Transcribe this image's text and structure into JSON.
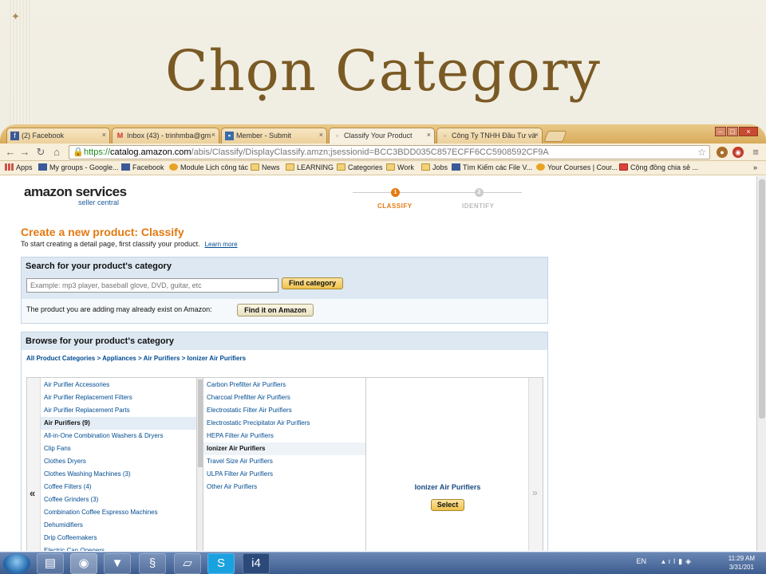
{
  "slide": {
    "title": "Chọn Category"
  },
  "browser": {
    "tabs": [
      {
        "label": "(2) Facebook",
        "icon": "facebook-icon"
      },
      {
        "label": "Inbox (43) - trinhmba@gm",
        "icon": "gmail-icon"
      },
      {
        "label": "Member - Submit",
        "icon": "page-icon"
      },
      {
        "label": "Classify Your Product",
        "icon": "page-icon"
      },
      {
        "label": "Công Ty TNHH Đầu Tư và",
        "icon": "page-icon"
      }
    ],
    "url": {
      "scheme": "https://",
      "host": "catalog.amazon.com",
      "path": "/abis/Classify/DisplayClassify.amzn;jsessionid=BCC3BDD035C857ECFF6CC5908592CF9A"
    },
    "bookmarks": [
      "Apps",
      "My groups - Google...",
      "Facebook",
      "Module Lịch công tác",
      "News",
      "LEARNING",
      "Categories",
      "Work",
      "Jobs",
      "Tìm Kiếm các File V...",
      "Your Courses | Cour...",
      "Cộng đồng chia sẻ ..."
    ],
    "bookmarks_more": "»"
  },
  "page": {
    "logo": "amazon services",
    "logo_sub": "seller central",
    "steps": [
      {
        "num": "1",
        "label": "CLASSIFY"
      },
      {
        "num": "2",
        "label": "IDENTIFY"
      }
    ],
    "heading": "Create a new product: Classify",
    "subheading": "To start creating a detail page, first classify your product.",
    "learn_more": "Learn more",
    "search": {
      "title": "Search for your product's category",
      "placeholder": "Example: mp3 player, baseball glove, DVD, guitar, etc",
      "button": "Find category",
      "exist_text": "The product you are adding may already exist on Amazon:",
      "exist_button": "Find it on Amazon"
    },
    "browse": {
      "title": "Browse for your product's category",
      "breadcrumb": [
        "All Product Categories",
        "Appliances",
        "Air Purifiers",
        "Ionizer Air Purifiers"
      ],
      "breadcrumb_sep": " > ",
      "column1": [
        "Air Purifier Accessories",
        "Air Purifier Replacement Filters",
        "Air Purifier Replacement Parts",
        "Air Purifiers (9)",
        "All-in-One Combination Washers & Dryers",
        "Clip Fans",
        "Clothes Dryers",
        "Clothes Washing Machines (3)",
        "Coffee Filters (4)",
        "Coffee Grinders (3)",
        "Combination Coffee Espresso Machines",
        "Dehumidifiers",
        "Drip Coffeemakers",
        "Electric Can Openers"
      ],
      "column2": [
        "Carbon Prefilter Air Purifiers",
        "Charcoal Prefilter Air Purifiers",
        "Electrostatic Filter Air Purifiers",
        "Electrostatic Precipitator Air Purifiers",
        "HEPA Filter Air Purifiers",
        "Ionizer Air Purifiers",
        "Travel Size Air Purifiers",
        "ULPA Filter Air Purifiers",
        "Other Air Purifiers"
      ],
      "selected_name": "Ionizer Air Purifiers",
      "select_button": "Select",
      "left_arrow": "«",
      "right_arrow": "»"
    }
  },
  "taskbar": {
    "language": "EN",
    "time": "11:29 AM",
    "date": "3/31/201"
  },
  "colors": {
    "amazon_orange": "#e47911",
    "link_blue": "#004b91",
    "title_brown": "#7a5a24"
  }
}
